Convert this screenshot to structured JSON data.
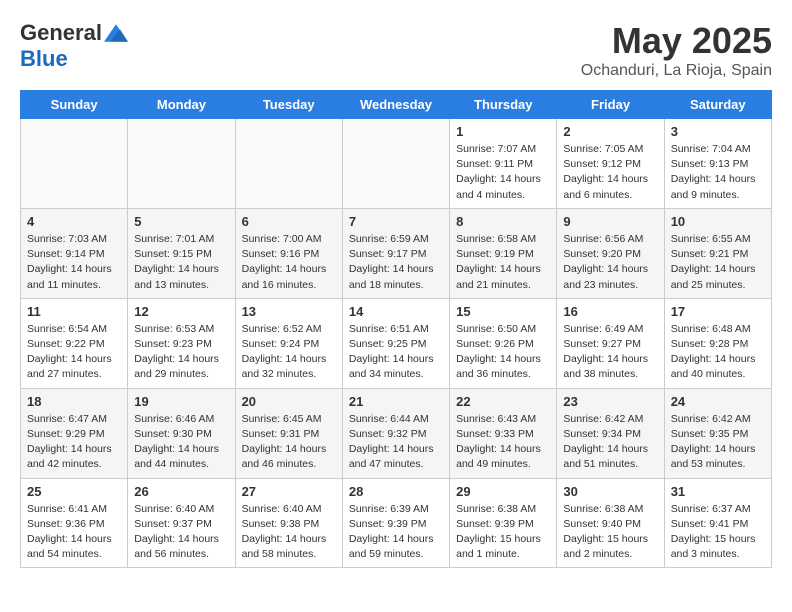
{
  "header": {
    "logo_general": "General",
    "logo_blue": "Blue",
    "month_title": "May 2025",
    "subtitle": "Ochanduri, La Rioja, Spain"
  },
  "weekdays": [
    "Sunday",
    "Monday",
    "Tuesday",
    "Wednesday",
    "Thursday",
    "Friday",
    "Saturday"
  ],
  "weeks": [
    [
      {
        "day": "",
        "info": ""
      },
      {
        "day": "",
        "info": ""
      },
      {
        "day": "",
        "info": ""
      },
      {
        "day": "",
        "info": ""
      },
      {
        "day": "1",
        "info": "Sunrise: 7:07 AM\nSunset: 9:11 PM\nDaylight: 14 hours\nand 4 minutes."
      },
      {
        "day": "2",
        "info": "Sunrise: 7:05 AM\nSunset: 9:12 PM\nDaylight: 14 hours\nand 6 minutes."
      },
      {
        "day": "3",
        "info": "Sunrise: 7:04 AM\nSunset: 9:13 PM\nDaylight: 14 hours\nand 9 minutes."
      }
    ],
    [
      {
        "day": "4",
        "info": "Sunrise: 7:03 AM\nSunset: 9:14 PM\nDaylight: 14 hours\nand 11 minutes."
      },
      {
        "day": "5",
        "info": "Sunrise: 7:01 AM\nSunset: 9:15 PM\nDaylight: 14 hours\nand 13 minutes."
      },
      {
        "day": "6",
        "info": "Sunrise: 7:00 AM\nSunset: 9:16 PM\nDaylight: 14 hours\nand 16 minutes."
      },
      {
        "day": "7",
        "info": "Sunrise: 6:59 AM\nSunset: 9:17 PM\nDaylight: 14 hours\nand 18 minutes."
      },
      {
        "day": "8",
        "info": "Sunrise: 6:58 AM\nSunset: 9:19 PM\nDaylight: 14 hours\nand 21 minutes."
      },
      {
        "day": "9",
        "info": "Sunrise: 6:56 AM\nSunset: 9:20 PM\nDaylight: 14 hours\nand 23 minutes."
      },
      {
        "day": "10",
        "info": "Sunrise: 6:55 AM\nSunset: 9:21 PM\nDaylight: 14 hours\nand 25 minutes."
      }
    ],
    [
      {
        "day": "11",
        "info": "Sunrise: 6:54 AM\nSunset: 9:22 PM\nDaylight: 14 hours\nand 27 minutes."
      },
      {
        "day": "12",
        "info": "Sunrise: 6:53 AM\nSunset: 9:23 PM\nDaylight: 14 hours\nand 29 minutes."
      },
      {
        "day": "13",
        "info": "Sunrise: 6:52 AM\nSunset: 9:24 PM\nDaylight: 14 hours\nand 32 minutes."
      },
      {
        "day": "14",
        "info": "Sunrise: 6:51 AM\nSunset: 9:25 PM\nDaylight: 14 hours\nand 34 minutes."
      },
      {
        "day": "15",
        "info": "Sunrise: 6:50 AM\nSunset: 9:26 PM\nDaylight: 14 hours\nand 36 minutes."
      },
      {
        "day": "16",
        "info": "Sunrise: 6:49 AM\nSunset: 9:27 PM\nDaylight: 14 hours\nand 38 minutes."
      },
      {
        "day": "17",
        "info": "Sunrise: 6:48 AM\nSunset: 9:28 PM\nDaylight: 14 hours\nand 40 minutes."
      }
    ],
    [
      {
        "day": "18",
        "info": "Sunrise: 6:47 AM\nSunset: 9:29 PM\nDaylight: 14 hours\nand 42 minutes."
      },
      {
        "day": "19",
        "info": "Sunrise: 6:46 AM\nSunset: 9:30 PM\nDaylight: 14 hours\nand 44 minutes."
      },
      {
        "day": "20",
        "info": "Sunrise: 6:45 AM\nSunset: 9:31 PM\nDaylight: 14 hours\nand 46 minutes."
      },
      {
        "day": "21",
        "info": "Sunrise: 6:44 AM\nSunset: 9:32 PM\nDaylight: 14 hours\nand 47 minutes."
      },
      {
        "day": "22",
        "info": "Sunrise: 6:43 AM\nSunset: 9:33 PM\nDaylight: 14 hours\nand 49 minutes."
      },
      {
        "day": "23",
        "info": "Sunrise: 6:42 AM\nSunset: 9:34 PM\nDaylight: 14 hours\nand 51 minutes."
      },
      {
        "day": "24",
        "info": "Sunrise: 6:42 AM\nSunset: 9:35 PM\nDaylight: 14 hours\nand 53 minutes."
      }
    ],
    [
      {
        "day": "25",
        "info": "Sunrise: 6:41 AM\nSunset: 9:36 PM\nDaylight: 14 hours\nand 54 minutes."
      },
      {
        "day": "26",
        "info": "Sunrise: 6:40 AM\nSunset: 9:37 PM\nDaylight: 14 hours\nand 56 minutes."
      },
      {
        "day": "27",
        "info": "Sunrise: 6:40 AM\nSunset: 9:38 PM\nDaylight: 14 hours\nand 58 minutes."
      },
      {
        "day": "28",
        "info": "Sunrise: 6:39 AM\nSunset: 9:39 PM\nDaylight: 14 hours\nand 59 minutes."
      },
      {
        "day": "29",
        "info": "Sunrise: 6:38 AM\nSunset: 9:39 PM\nDaylight: 15 hours\nand 1 minute."
      },
      {
        "day": "30",
        "info": "Sunrise: 6:38 AM\nSunset: 9:40 PM\nDaylight: 15 hours\nand 2 minutes."
      },
      {
        "day": "31",
        "info": "Sunrise: 6:37 AM\nSunset: 9:41 PM\nDaylight: 15 hours\nand 3 minutes."
      }
    ]
  ]
}
